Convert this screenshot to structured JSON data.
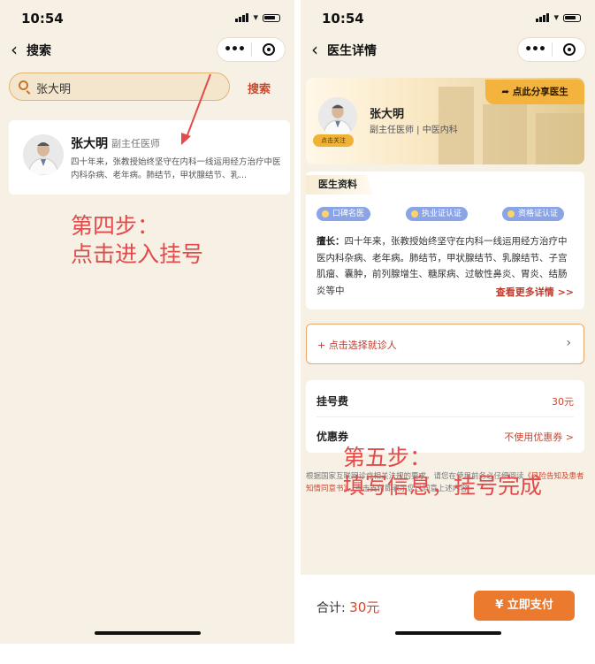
{
  "left": {
    "status_time": "10:54",
    "nav_title": "搜索",
    "search": {
      "value": "张大明",
      "button": "搜索"
    },
    "doctor_card": {
      "name": "张大明",
      "title": "副主任医师",
      "desc": "四十年来，张教授始终坚守在内科一线运用经方治疗中医内科杂病、老年病。肺结节，甲状腺结节、乳..."
    },
    "annotation": [
      "第四步：",
      "点击进入挂号"
    ]
  },
  "right": {
    "status_time": "10:54",
    "nav_title": "医生详情",
    "profile": {
      "name": "张大明",
      "title": "副主任医师 | 中医内科",
      "follow": "点击关注",
      "share": "点此分享医生"
    },
    "info": {
      "section_label": "医生资料",
      "badges": [
        "口碑名医",
        "执业证认证",
        "资格证认证"
      ],
      "specialty_label": "擅长：",
      "specialty_text": "四十年来，张教授始终坚守在内科一线运用经方治疗中医内科杂病、老年病。肺结节，甲状腺结节、乳腺结节、子宫肌瘤、囊肿，前列腺增生、糖尿病、过敏性鼻炎、胃炎、结肠炎等中",
      "more": "查看更多详情 >>"
    },
    "patient_select": "+ 点击选择就诊人",
    "fees": [
      {
        "label": "挂号费",
        "value": "30元"
      },
      {
        "label": "优惠券",
        "value": "不使用优惠券 >"
      }
    ],
    "notice_text": "根据国家互联网诊疗相关法规的要求，请您在使用前务必仔细阅读",
    "notice_link": "《风险告知及患者知情同意书》",
    "notice_tail": "，点击支付即表示您已同意上述内容",
    "footer": {
      "total_label": "合计:",
      "total_value": "30元",
      "pay_button": "¥ 立即支付"
    },
    "annotation": [
      "第五步：",
      "填写信息，挂号完成"
    ]
  },
  "colors": {
    "accent": "#d2452c",
    "pay": "#ec7a2e",
    "share": "#f3b33d",
    "badge": "#8aa4e6",
    "annotation": "#e24b4b"
  }
}
